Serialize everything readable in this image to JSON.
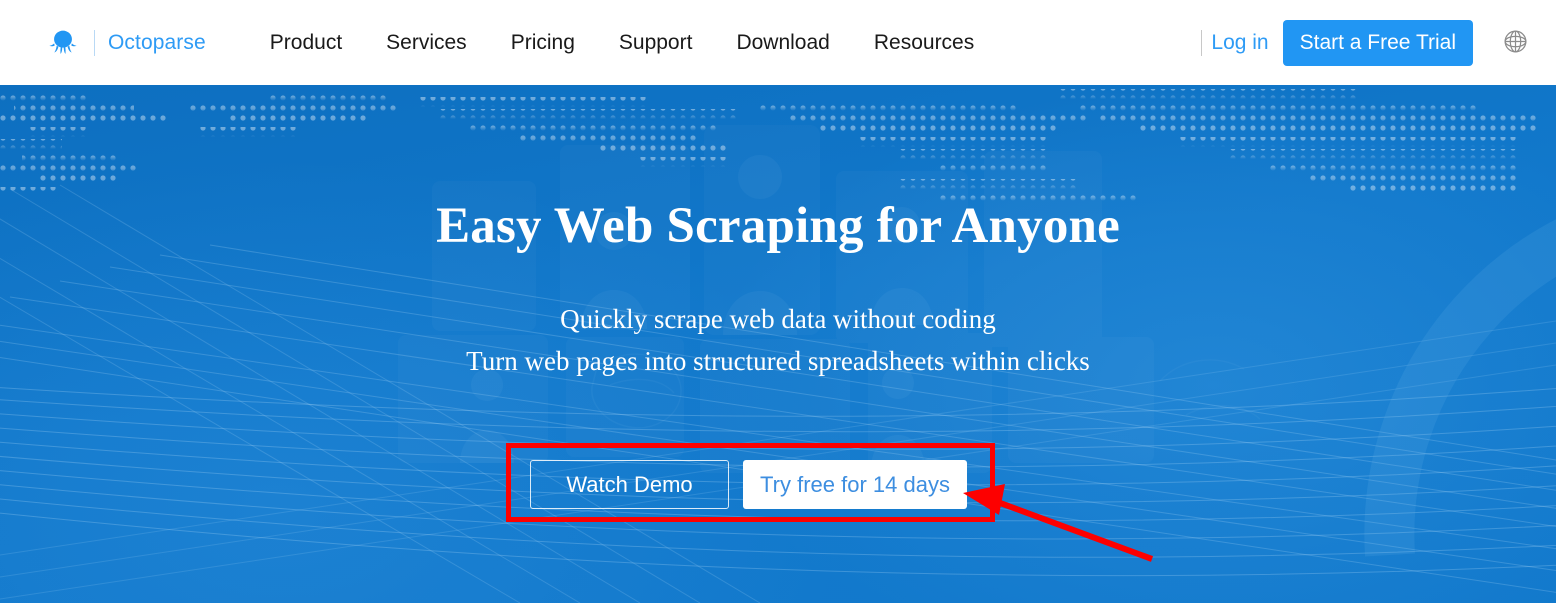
{
  "navbar": {
    "logo_icon": "octopus-logo-icon",
    "brand_name": "Octoparse",
    "links": [
      {
        "label": "Product"
      },
      {
        "label": "Services"
      },
      {
        "label": "Pricing"
      },
      {
        "label": "Support"
      },
      {
        "label": "Download"
      },
      {
        "label": "Resources"
      }
    ],
    "login_label": "Log in",
    "trial_button_label": "Start a Free Trial",
    "language_icon": "globe-icon",
    "accent_color": "#2196f3",
    "link_color": "#2e9bf5",
    "background": "#ffffff"
  },
  "hero": {
    "title": "Easy Web Scraping for Anyone",
    "subtitle_line1": "Quickly scrape web data without coding",
    "subtitle_line2": "Turn web pages into structured spreadsheets within clicks",
    "watch_demo_label": "Watch Demo",
    "try_free_label": "Try free for 14 days",
    "background_color": "#0f74c7",
    "try_free_text_color": "#3d8ee0"
  },
  "annotations": {
    "highlight_color": "#fd0000",
    "highlight_target": "cta-button-group",
    "arrow_points_to": "try-free-button"
  }
}
